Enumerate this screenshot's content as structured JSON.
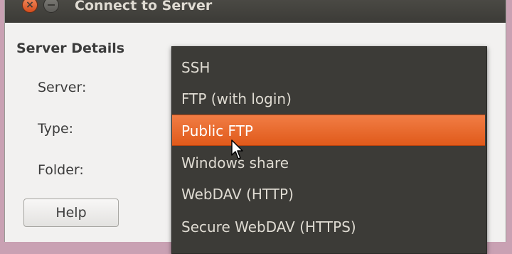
{
  "window": {
    "title": "Connect to Server"
  },
  "form": {
    "section_title": "Server Details",
    "labels": {
      "server": "Server:",
      "type": "Type:",
      "folder": "Folder:"
    },
    "help_label": "Help"
  },
  "dropdown": {
    "selected": "Public FTP",
    "items": [
      {
        "label": "SSH"
      },
      {
        "label": "FTP (with login)"
      },
      {
        "label": "Public FTP"
      },
      {
        "label": "Windows share"
      },
      {
        "label": "WebDAV (HTTP)"
      },
      {
        "label": "Secure WebDAV (HTTPS)"
      }
    ]
  },
  "colors": {
    "titlebar": "#3c3b37",
    "menu_background": "#3c3b37",
    "highlight": "#e8652a",
    "window_background": "#f2f1f0"
  },
  "icons": [
    "close-icon",
    "minimize-icon",
    "mouse-pointer-icon"
  ]
}
